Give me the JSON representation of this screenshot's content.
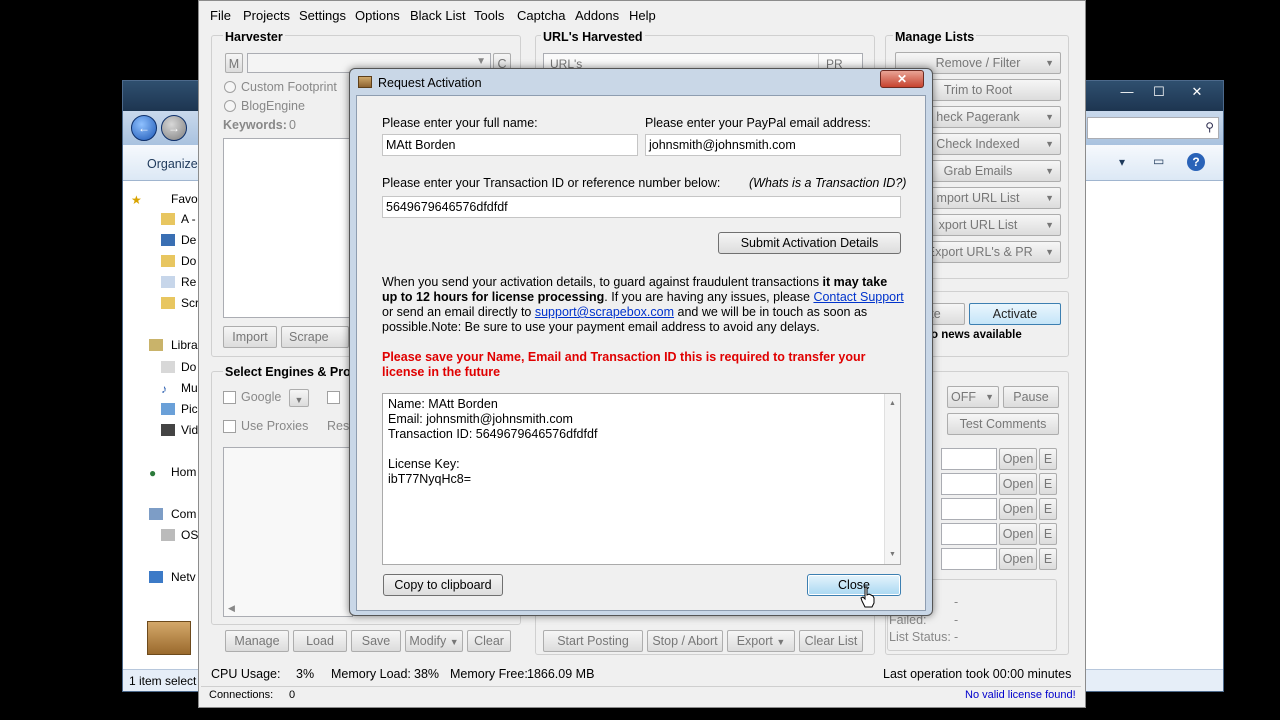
{
  "explorer": {
    "command_organize": "Organize",
    "sidebar_items": [
      "Favo",
      "A -",
      "De",
      "Do",
      "Re",
      "Scr",
      "Libra",
      "Do",
      "Mu",
      "Pic",
      "Vid",
      "Hom",
      "Com",
      "OS",
      "Netv"
    ],
    "status_text": "1 item select"
  },
  "menu": [
    "File",
    "Projects",
    "Settings",
    "Options",
    "Black List",
    "Tools",
    "Captcha",
    "Addons",
    "Help"
  ],
  "harvester": {
    "title": "Harvester",
    "m_label": "M",
    "c_label": "C",
    "custom_footprint": "Custom Footprint",
    "blogengine": "BlogEngine",
    "keywords_label": "Keywords:",
    "keywords_count": "0",
    "import": "Import",
    "scrape": "Scrape"
  },
  "urls": {
    "title": "URL's Harvested",
    "col_urls": "URL's",
    "col_pr": "PR"
  },
  "manage_lists": {
    "title": "Manage Lists",
    "items": [
      "Remove / Filter",
      "Trim to Root",
      "heck Pagerank",
      "Check Indexed",
      "Grab Emails",
      "mport URL List",
      "xport URL List",
      "/Export URL's & PR"
    ]
  },
  "license": {
    "update_partial": "ate",
    "activate": "Activate",
    "news": "o news available"
  },
  "engines": {
    "title": "Select Engines & Prox",
    "google": "Google",
    "use_proxies": "Use Proxies",
    "res": "Res"
  },
  "comment_poster": {
    "off": "OFF",
    "pause": "Pause",
    "test_comments": "Test Comments",
    "open": "Open",
    "e": "E",
    "failed": "Failed:",
    "list_status": "List Status:",
    "dash": "-"
  },
  "bottom_buttons": {
    "manage": "Manage",
    "load": "Load",
    "save": "Save",
    "modify": "Modify",
    "clear": "Clear",
    "start_posting": "Start Posting",
    "stop_abort": "Stop / Abort",
    "export": "Export",
    "clear_list": "Clear List"
  },
  "statusbar": {
    "cpu_label": "CPU Usage:",
    "cpu_value": "3%",
    "mem_label": "Memory Load:",
    "mem_value": "38%",
    "free_label": "Memory Free:",
    "free_value": "1866.09 MB",
    "last_op": "Last operation took 00:00 minutes",
    "connections_label": "Connections:",
    "connections_value": "0",
    "license_status": "No valid license found!"
  },
  "dialog": {
    "title": "Request Activation",
    "close_x": "✕",
    "name_label": "Please enter your full name:",
    "name_value": "MAtt Borden",
    "email_label": "Please enter your PayPal email address:",
    "email_value": "johnsmith@johnsmith.com",
    "txn_label": "Please enter your Transaction ID  or reference number below:",
    "txn_help": "(Whats is a Transaction ID?)",
    "txn_value": "5649679646576dfdfdf",
    "submit": "Submit Activation Details",
    "info_1": "When you send your activation details, to guard against fraudulent transactions ",
    "info_bold": "it may take up to 12 hours for license processing",
    "info_2": ". If you are having any issues, please ",
    "info_link1": "Contact Support",
    "info_3": " or send an email directly to ",
    "info_link2": "support@scrapebox.com",
    "info_4": " and we will be in touch as soon as possible.Note: Be sure to use your payment email address to avoid any delays.",
    "warning": "Please save your Name, Email and Transaction ID this is required to transfer your license in the future",
    "key_box": "Name: MAtt Borden\nEmail: johnsmith@johnsmith.com\nTransaction ID: 5649679646576dfdfdf\n\nLicense Key:\nibT77NyqHc8=",
    "copy": "Copy to clipboard",
    "close": "Close"
  }
}
